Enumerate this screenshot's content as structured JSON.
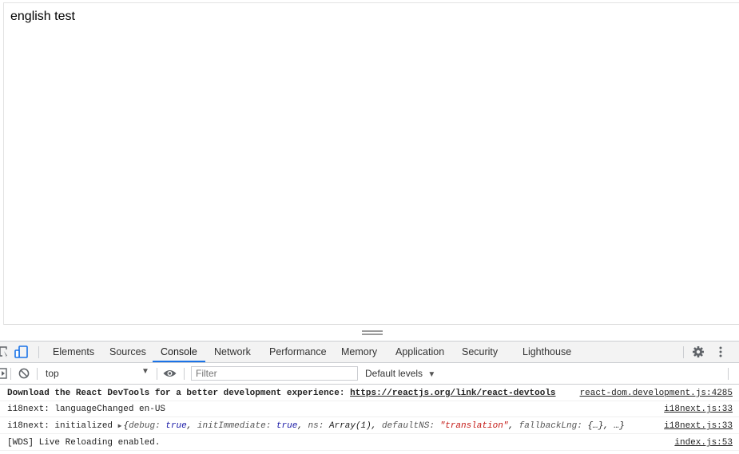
{
  "page": {
    "content_text": "english test"
  },
  "devtools": {
    "tabs": [
      "Elements",
      "Sources",
      "Console",
      "Network",
      "Performance",
      "Memory",
      "Application",
      "Security",
      "Lighthouse"
    ],
    "active_tab": "Console",
    "toolbar": {
      "context": "top",
      "filter_placeholder": "Filter",
      "default_levels": "Default levels"
    },
    "messages": [
      {
        "prefix": "Download the React DevTools for a better development experience: ",
        "link": "https://reactjs.org/link/react-devtools",
        "source": "react-dom.development.js:4285"
      },
      {
        "text": "i18next: languageChanged en-US",
        "source": "i18next.js:33"
      },
      {
        "prefix": "i18next: initialized ",
        "obj_open": "{",
        "k1": "debug: ",
        "v1": "true",
        "c1": ", ",
        "k2": "initImmediate: ",
        "v2": "true",
        "c2": ", ",
        "k3": "ns: ",
        "v3": "Array(1)",
        "c3": ", ",
        "k4": "defaultNS: ",
        "v4": "\"translation\"",
        "c4": ", ",
        "k5": "fallbackLng: ",
        "v5": "{…}",
        "c5": ", …",
        "obj_close": "}",
        "source": "i18next.js:33"
      },
      {
        "text": "[WDS] Live Reloading enabled.",
        "source": "index.js:53"
      }
    ]
  },
  "icons": [
    "inspect-element-icon",
    "device-toggle-icon",
    "settings-gear-icon",
    "more-vert-icon",
    "sidebar-toggle-icon",
    "clear-console-icon",
    "eye-icon",
    "expand-triangle-icon"
  ],
  "colors": {
    "active_tab_underline": "#1a73e8",
    "keyword_blue": "#1a1aa6",
    "string_red": "#c41a16",
    "device_icon_blue": "#1a73e8"
  }
}
